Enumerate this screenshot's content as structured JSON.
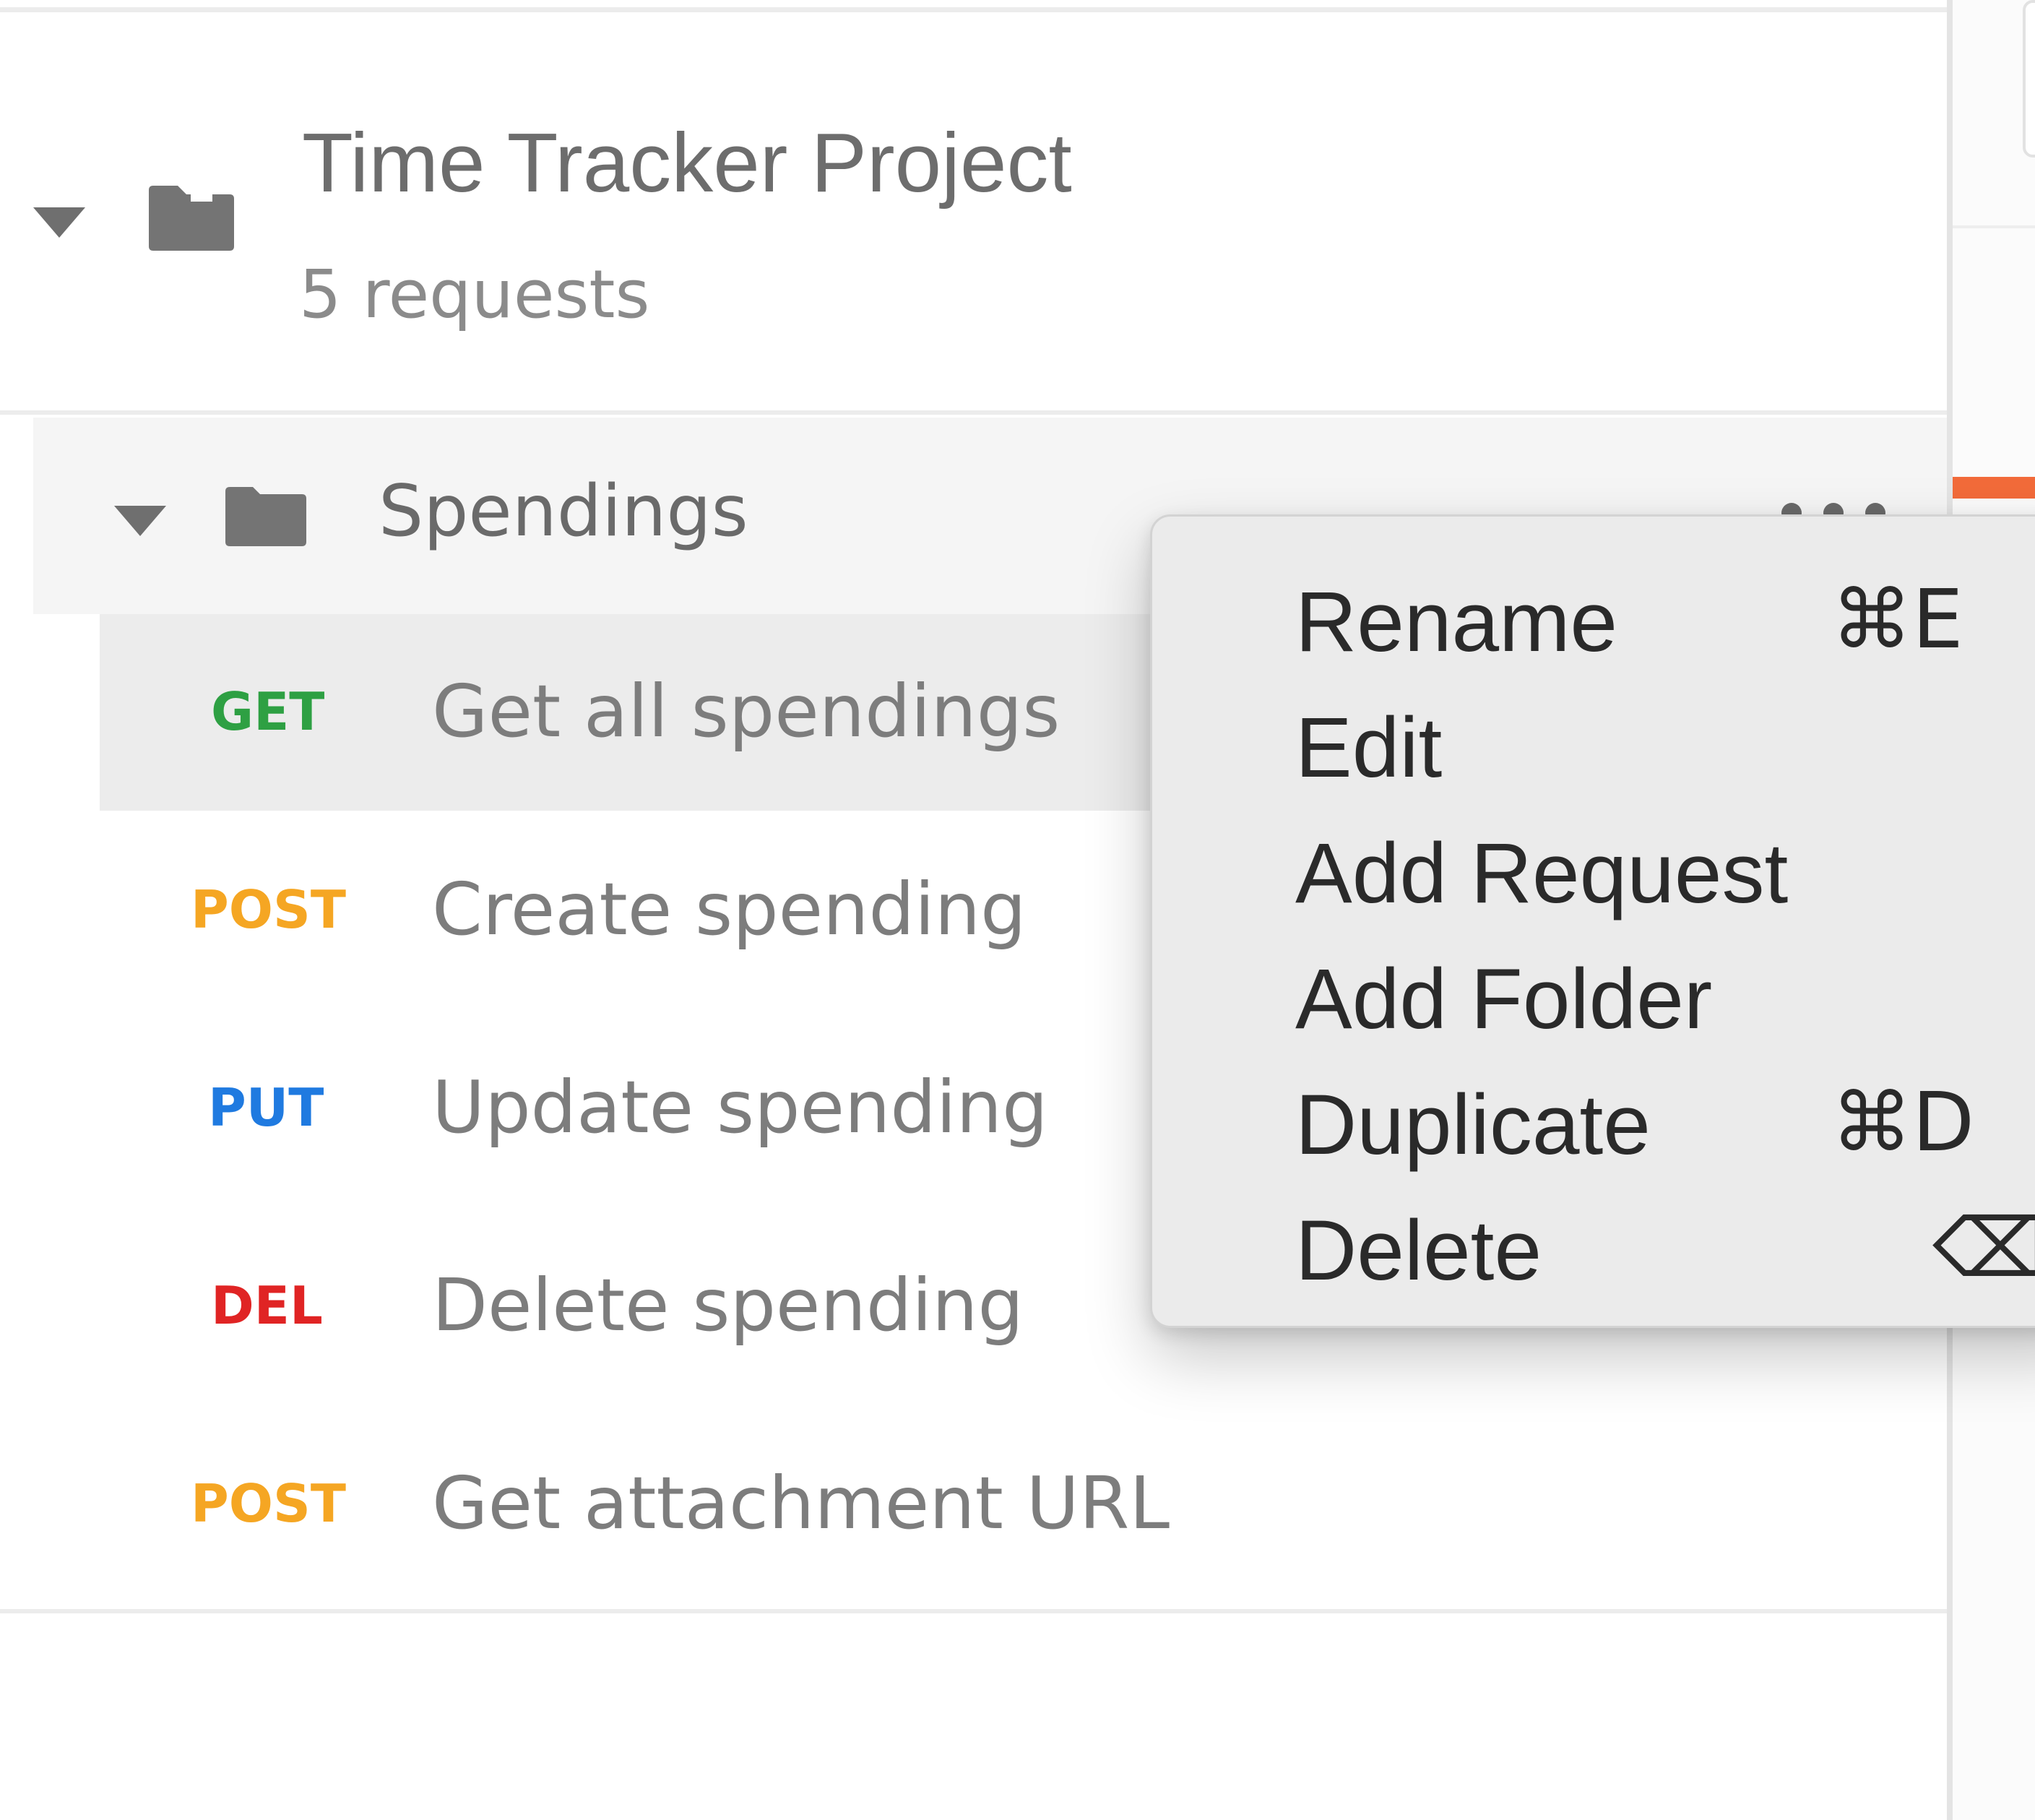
{
  "collection": {
    "title": "Time Tracker Project",
    "subtitle": "5 requests"
  },
  "folder": {
    "label": "Spendings"
  },
  "requests": [
    {
      "method": "GET",
      "method_color": "#2ea043",
      "name": "Get all spendings",
      "selected": true
    },
    {
      "method": "POST",
      "method_color": "#f5a623",
      "name": "Create spending"
    },
    {
      "method": "PUT",
      "method_color": "#1f7ae0",
      "name": "Update spending"
    },
    {
      "method": "DEL",
      "method_color": "#e02424",
      "name": "Delete spending"
    },
    {
      "method": "POST",
      "method_color": "#f5a623",
      "name": "Get attachment URL"
    }
  ],
  "context_menu": {
    "items": [
      {
        "label": "Rename",
        "shortcut": "⌘E"
      },
      {
        "label": "Edit",
        "shortcut": ""
      },
      {
        "label": "Add Request",
        "shortcut": ""
      },
      {
        "label": "Add Folder",
        "shortcut": ""
      },
      {
        "label": "Duplicate",
        "shortcut": "⌘D"
      },
      {
        "label": "Delete",
        "shortcut": "⌫",
        "shortcut_icon": "delete-key-icon"
      }
    ]
  },
  "colors": {
    "text_primary": "#6d6d6d",
    "menu_text": "#2a2a2a",
    "selected_row_bg": "#ececec",
    "folder_row_bg": "#f5f5f5",
    "menu_bg": "#ebebeb",
    "accent": "#f26b3a"
  }
}
